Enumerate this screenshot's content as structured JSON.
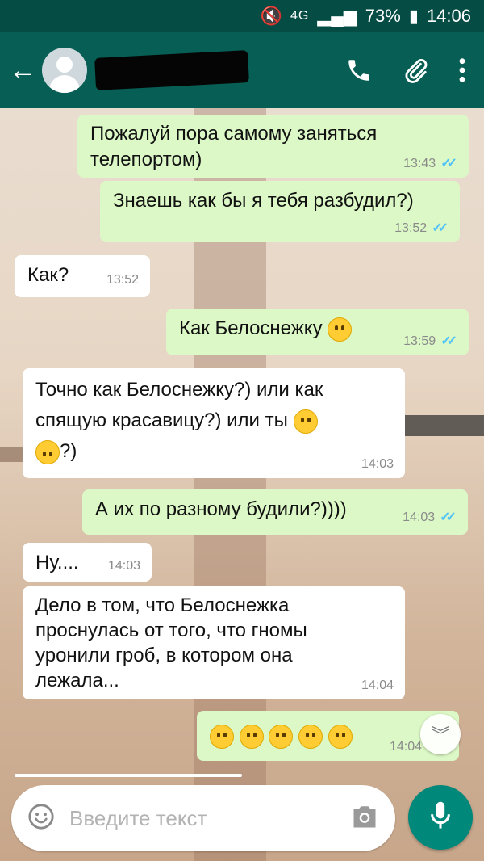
{
  "status_bar": {
    "network": "4G",
    "battery": "73%",
    "time": "14:06"
  },
  "header": {
    "back_icon": "arrow-left-icon",
    "avatar": "default-avatar-icon",
    "contact_name": ""
  },
  "messages": [
    {
      "dir": "out",
      "text": "Пожалуй пора самому заняться\nтелепортом)",
      "time": "13:43",
      "read": true
    },
    {
      "dir": "out",
      "text": "Знаешь как бы я тебя разбудил?)",
      "time": "13:52",
      "read": true
    },
    {
      "dir": "in",
      "text": "Как?",
      "time": "13:52"
    },
    {
      "dir": "out",
      "text": "Как Белоснежку",
      "time": "13:59",
      "read": true
    },
    {
      "dir": "in",
      "text": "Точно как Белоснежку?) или как\nспящую красавицу?) или ты",
      "text_end": "?)",
      "time": "14:03"
    },
    {
      "dir": "out",
      "text": "А их по разному будили?))))",
      "time": "14:03",
      "read": true
    },
    {
      "dir": "in",
      "text": "Ну....",
      "time": "14:03"
    },
    {
      "dir": "in",
      "text": "Дело в том, что Белоснежка\nпроснулась от того, что гномы\nуронили гроб, в котором она\nлежала...",
      "time": "14:04"
    },
    {
      "dir": "out",
      "text": "",
      "time": "14:04",
      "read": true
    }
  ],
  "composer": {
    "placeholder": "Введите текст"
  },
  "colors": {
    "header": "#075e54",
    "status": "#054d44",
    "outgoing": "#dcf8c6",
    "incoming": "#ffffff",
    "fab": "#00897b",
    "ticks": "#4fc3f7"
  }
}
